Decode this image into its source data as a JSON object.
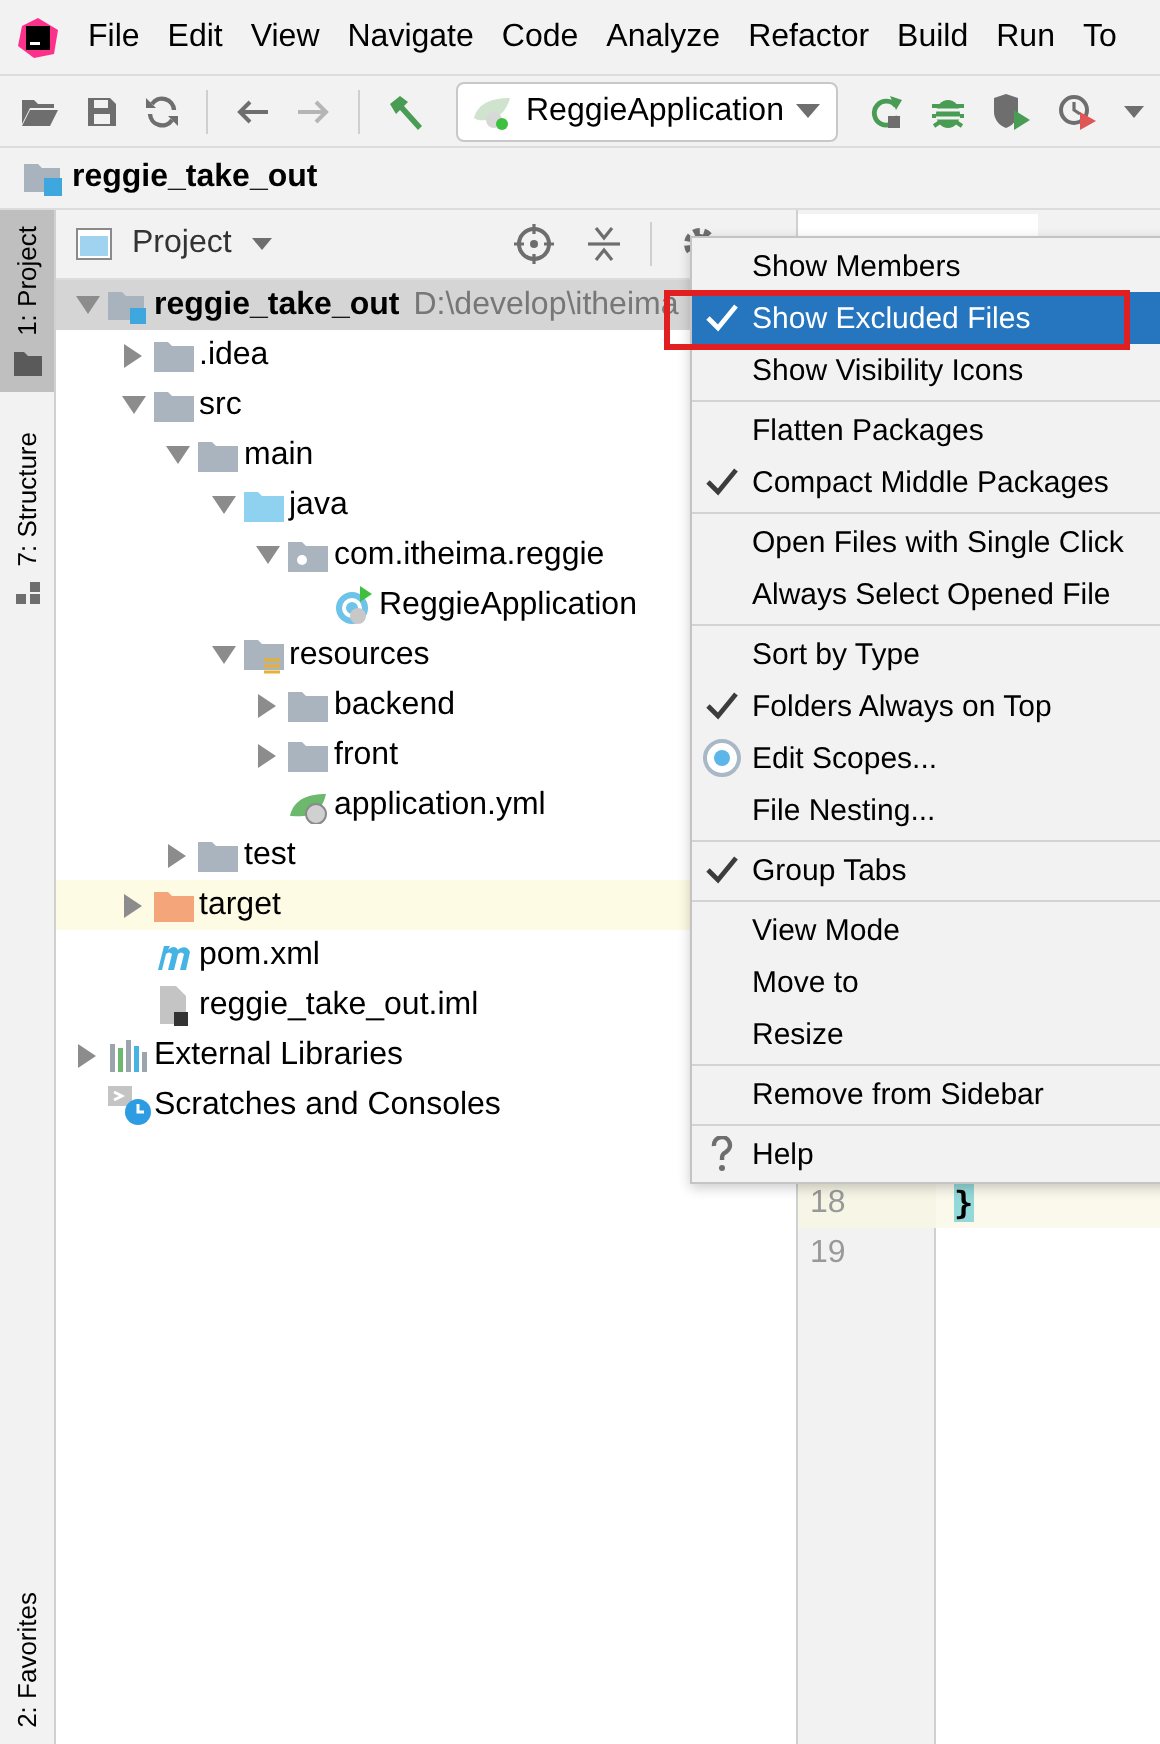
{
  "menu_bar": {
    "items": [
      "File",
      "Edit",
      "View",
      "Navigate",
      "Code",
      "Analyze",
      "Refactor",
      "Build",
      "Run",
      "To"
    ]
  },
  "toolbar": {
    "run_configuration": "ReggieApplication"
  },
  "breadcrumb": "reggie_take_out",
  "tool_stripe": {
    "top": [
      {
        "label": "1: Project",
        "selected": true,
        "kind": "project"
      },
      {
        "label": "7: Structure",
        "selected": false,
        "kind": "structure"
      }
    ],
    "bottom": [
      {
        "label": "2: Favorites",
        "selected": false
      }
    ]
  },
  "project_panel": {
    "title": "Project",
    "tree": [
      {
        "label": "reggie_take_out",
        "path": "D:\\develop\\itheima",
        "kind": "module",
        "expanded": true,
        "selected": true,
        "excluded": false,
        "children": [
          {
            "label": ".idea",
            "kind": "folder",
            "expanded": false,
            "selected": false,
            "excluded": false
          },
          {
            "label": "src",
            "kind": "folder",
            "expanded": true,
            "selected": false,
            "excluded": false,
            "children": [
              {
                "label": "main",
                "kind": "folder",
                "expanded": true,
                "selected": false,
                "excluded": false,
                "children": [
                  {
                    "label": "java",
                    "kind": "source",
                    "expanded": true,
                    "selected": false,
                    "excluded": false,
                    "children": [
                      {
                        "label": "com.itheima.reggie",
                        "kind": "package",
                        "expanded": true,
                        "selected": false,
                        "excluded": false,
                        "children": [
                          {
                            "label": "ReggieApplication",
                            "kind": "class",
                            "selected": false,
                            "excluded": false
                          }
                        ]
                      }
                    ]
                  },
                  {
                    "label": "resources",
                    "kind": "resources",
                    "expanded": true,
                    "selected": false,
                    "excluded": false,
                    "children": [
                      {
                        "label": "backend",
                        "kind": "folder",
                        "expanded": false,
                        "selected": false,
                        "excluded": false
                      },
                      {
                        "label": "front",
                        "kind": "folder",
                        "expanded": false,
                        "selected": false,
                        "excluded": false
                      },
                      {
                        "label": "application.yml",
                        "kind": "config",
                        "selected": false,
                        "excluded": false
                      }
                    ]
                  }
                ]
              },
              {
                "label": "test",
                "kind": "folder",
                "expanded": false,
                "selected": false,
                "excluded": false
              }
            ]
          },
          {
            "label": "target",
            "kind": "folder",
            "expanded": false,
            "selected": false,
            "excluded": true
          },
          {
            "label": "pom.xml",
            "kind": "maven",
            "selected": false,
            "excluded": false
          },
          {
            "label": "reggie_take_out.iml",
            "kind": "module-file",
            "selected": false,
            "excluded": false
          }
        ]
      },
      {
        "label": "External Libraries",
        "kind": "libraries",
        "expanded": false,
        "selected": false,
        "excluded": false
      },
      {
        "label": "Scratches and Consoles",
        "kind": "scratches",
        "selected": false,
        "excluded": false
      }
    ]
  },
  "editor": {
    "lines": [
      {
        "number": "18",
        "current": true,
        "text": "}"
      },
      {
        "number": "19",
        "current": false
      }
    ]
  },
  "popup_menu": {
    "groups": [
      [
        {
          "label": "Show Members",
          "kind": "check",
          "checked": false,
          "selected": false,
          "marked": false
        },
        {
          "label": "Show Excluded Files",
          "kind": "check",
          "checked": true,
          "selected": true,
          "marked": true
        },
        {
          "label": "Show Visibility Icons",
          "kind": "check",
          "checked": false,
          "selected": false,
          "marked": false
        }
      ],
      [
        {
          "label": "Flatten Packages",
          "kind": "check",
          "checked": false,
          "selected": false,
          "marked": false
        },
        {
          "label": "Compact Middle Packages",
          "kind": "check",
          "checked": true,
          "selected": false,
          "marked": false
        }
      ],
      [
        {
          "label": "Open Files with Single Click",
          "kind": "check",
          "checked": false,
          "selected": false,
          "marked": false
        },
        {
          "label": "Always Select Opened File",
          "kind": "check",
          "checked": false,
          "selected": false,
          "marked": false
        }
      ],
      [
        {
          "label": "Sort by Type",
          "kind": "check",
          "checked": false,
          "selected": false,
          "marked": false
        },
        {
          "label": "Folders Always on Top",
          "kind": "check",
          "checked": true,
          "selected": false,
          "marked": false
        },
        {
          "label": "Edit Scopes...",
          "kind": "scope",
          "selected": false,
          "marked": false
        },
        {
          "label": "File Nesting...",
          "kind": "check",
          "checked": false,
          "selected": false,
          "marked": false
        }
      ],
      [
        {
          "label": "Group Tabs",
          "kind": "check",
          "checked": true,
          "selected": false,
          "marked": false
        }
      ],
      [
        {
          "label": "View Mode",
          "kind": "check",
          "checked": false,
          "selected": false,
          "marked": false
        },
        {
          "label": "Move to",
          "kind": "check",
          "checked": false,
          "selected": false,
          "marked": false
        },
        {
          "label": "Resize",
          "kind": "check",
          "checked": false,
          "selected": false,
          "marked": false
        }
      ],
      [
        {
          "label": "Remove from Sidebar",
          "kind": "check",
          "checked": false,
          "selected": false,
          "marked": false
        }
      ],
      [
        {
          "label": "Help",
          "kind": "help",
          "selected": false,
          "marked": false
        }
      ]
    ]
  }
}
